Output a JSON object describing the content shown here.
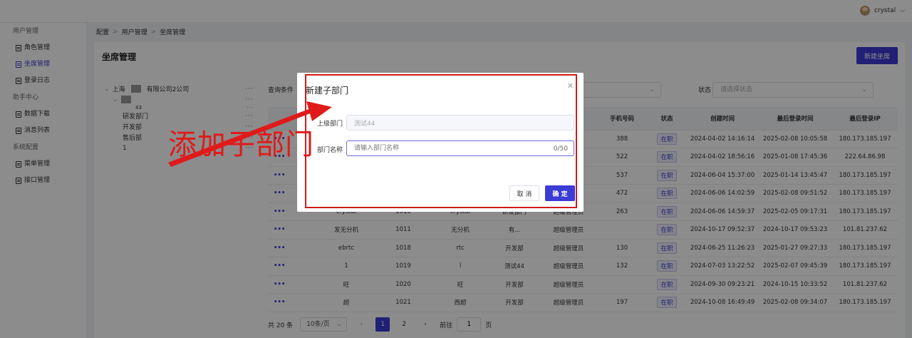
{
  "header": {
    "username": "crystal"
  },
  "sidebar": {
    "groups": [
      {
        "label": "用户管理",
        "items": [
          {
            "label": "角色管理"
          },
          {
            "label": "坐席管理",
            "active": true
          },
          {
            "label": "登录日志"
          }
        ]
      },
      {
        "label": "助手中心",
        "items": [
          {
            "label": "数据下载"
          },
          {
            "label": "消息列表"
          }
        ]
      },
      {
        "label": "系统配置",
        "items": [
          {
            "label": "菜单管理"
          },
          {
            "label": "接口管理"
          }
        ]
      }
    ]
  },
  "breadcrumb": [
    "配置",
    "用户管理",
    "坐席管理"
  ],
  "page": {
    "title": "坐席管理",
    "new_button": "新建坐席"
  },
  "tree": {
    "root_prefix": "上海",
    "root_suffix": "有限公司",
    "nodes": [
      "研发部门",
      "开发部",
      "售后部",
      "1"
    ],
    "partial": "43"
  },
  "filters": {
    "query_label": "查询条件",
    "status_label": "状态",
    "status_placeholder": "请选择状态"
  },
  "table": {
    "headers": [
      "手机号码",
      "状态",
      "创建时间",
      "最后登录时间",
      "最后登录IP"
    ],
    "rows": [
      {
        "phone": "388",
        "status": "在职",
        "created": "2024-04-02 14:16:14",
        "last_login": "2025-02-08 10:05:58",
        "ip": "180.173.185.197"
      },
      {
        "phone": "522",
        "status": "在职",
        "created": "2024-04-02 18:56:16",
        "last_login": "2025-01-08 17:45:36",
        "ip": "222.64.86.98"
      },
      {
        "phone": "537",
        "status": "在职",
        "created": "2024-06-04 15:37:00",
        "last_login": "2025-01-14 13:45:47",
        "ip": "180.173.185.197"
      },
      {
        "phone": "472",
        "status": "在职",
        "created": "2024-06-06 14:02:59",
        "last_login": "2025-02-08 09:51:52",
        "ip": "180.173.185.197"
      },
      {
        "phone": "263",
        "status": "在职",
        "created": "2024-06-06 14:59:37",
        "last_login": "2025-02-05 09:17:31",
        "ip": "180.173.185.197",
        "name": "crystal",
        "id": "1010",
        "account": "crystal",
        "dept": "研发部门",
        "role": "超级管理员"
      },
      {
        "phone": "",
        "status": "在职",
        "created": "2024-10-17 09:52:37",
        "last_login": "2024-10-17 09:53:23",
        "ip": "101.81.237.62",
        "name": "发无分机",
        "id": "1011",
        "account": "无分机",
        "dept": "有...",
        "role": "超级管理员"
      },
      {
        "phone": "130",
        "status": "在职",
        "created": "2024-06-25 11:26:23",
        "last_login": "2025-01-27 09:27:33",
        "ip": "180.173.185.197",
        "name": "ebrtc",
        "id": "1018",
        "account": "rtc",
        "dept": "开发部",
        "role": "超级管理员"
      },
      {
        "phone": "132",
        "status": "在职",
        "created": "2024-07-03 13:22:52",
        "last_login": "2025-02-07 09:45:39",
        "ip": "180.173.185.197",
        "name": "1",
        "id": "1019",
        "account": "l",
        "dept": "测试44",
        "role": "超级管理员"
      },
      {
        "phone": "",
        "status": "在职",
        "created": "2024-09-30 09:23:21",
        "last_login": "2024-10-15 10:33:52",
        "ip": "101.81.237.62",
        "name": "旺",
        "id": "1020",
        "account": "旺",
        "dept": "开发部",
        "role": "超级管理员"
      },
      {
        "phone": "197",
        "status": "在职",
        "created": "2024-10-08 16:49:49",
        "last_login": "2025-02-08 09:34:07",
        "ip": "180.173.185.197",
        "name": "超",
        "id": "1021",
        "account": "西超",
        "dept": "开发部",
        "role": "超级管理员"
      }
    ]
  },
  "pagination": {
    "total": "共 20 条",
    "page_size": "10条/页",
    "pages": [
      "1",
      "2"
    ],
    "goto_label": "前往",
    "goto_value": "1",
    "page_suffix": "页"
  },
  "modal": {
    "title": "新建子部门",
    "parent_label": "上级部门",
    "parent_value": "测试44",
    "name_label": "部门名称",
    "name_placeholder": "请输入部门名称",
    "counter": "0/50",
    "cancel": "取 消",
    "confirm": "确 定"
  },
  "annotation": {
    "text": "添加子部门",
    "color": "#e01a1a"
  }
}
